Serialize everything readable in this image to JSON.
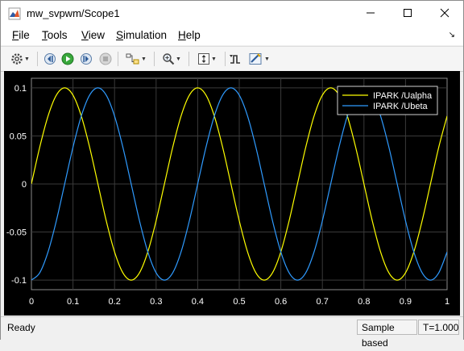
{
  "window": {
    "title": "mw_svpwm/Scope1",
    "controls": [
      "minimize-icon",
      "maximize-icon",
      "close-icon"
    ]
  },
  "menubar": {
    "items": [
      {
        "label": "File",
        "mnemonic": "F"
      },
      {
        "label": "Tools",
        "mnemonic": "T"
      },
      {
        "label": "View",
        "mnemonic": "V"
      },
      {
        "label": "Simulation",
        "mnemonic": "S"
      },
      {
        "label": "Help",
        "mnemonic": "H"
      }
    ]
  },
  "toolbar": {
    "icons": [
      "settings-icon",
      "step-back-icon",
      "run-icon",
      "step-forward-icon",
      "stop-icon",
      "highlight-block-icon",
      "zoom-icon",
      "autoscale-icon",
      "triggers-icon",
      "measurements-icon"
    ]
  },
  "colors": {
    "ualpha": "#ffff00",
    "ubeta": "#2f9bff",
    "plot_bg": "#000000",
    "grid": "#3a3a3a",
    "axis_text": "#ffffff"
  },
  "chart_data": {
    "type": "line",
    "title": "",
    "xlabel": "",
    "ylabel": "",
    "xlim": [
      0,
      1
    ],
    "ylim": [
      -0.11,
      0.11
    ],
    "xticks": [
      "0",
      "0.1",
      "0.2",
      "0.3",
      "0.4",
      "0.5",
      "0.6",
      "0.7",
      "0.8",
      "0.9",
      "1"
    ],
    "yticks": [
      "0.1",
      "0.05",
      "0",
      "-0.05",
      "-0.1"
    ],
    "ytick_values": [
      0.1,
      0.05,
      0,
      -0.05,
      -0.1
    ],
    "grid": true,
    "legend_position": "top-right",
    "series": [
      {
        "name": "IPARK /Ualpha",
        "color": "#ffff00",
        "x": [
          0,
          0.02,
          0.04,
          0.06,
          0.08,
          0.1,
          0.12,
          0.14,
          0.16,
          0.18,
          0.2,
          0.22,
          0.24,
          0.26,
          0.28,
          0.3,
          0.32,
          0.34,
          0.36,
          0.38,
          0.4,
          0.42,
          0.44,
          0.46,
          0.48,
          0.5,
          0.52,
          0.54,
          0.56,
          0.58,
          0.6,
          0.62,
          0.64,
          0.66,
          0.68,
          0.7,
          0.72,
          0.74,
          0.76,
          0.78,
          0.8,
          0.82,
          0.84,
          0.86,
          0.88,
          0.9,
          0.92,
          0.94,
          0.96,
          0.98,
          1.0
        ],
        "values": [
          0,
          0.0383,
          0.0707,
          0.0924,
          0.1,
          0.0924,
          0.0707,
          0.0383,
          0,
          -0.0383,
          -0.0707,
          -0.0924,
          -0.1,
          -0.0924,
          -0.0707,
          -0.0383,
          0,
          0.0383,
          0.0707,
          0.0924,
          0.1,
          0.0924,
          0.0707,
          0.0383,
          0,
          -0.0383,
          -0.0707,
          -0.0924,
          -0.1,
          -0.0924,
          -0.0707,
          -0.0383,
          0,
          0.0383,
          0.0707,
          0.0924,
          0.1,
          0.0924,
          0.0707,
          0.0383,
          0,
          -0.0383,
          -0.0707,
          -0.0924,
          -0.1,
          -0.0924,
          -0.0707,
          -0.0383,
          0,
          0.0383,
          0.0707
        ]
      },
      {
        "name": "IPARK /Ubeta",
        "color": "#2f9bff",
        "x": [
          0,
          0.02,
          0.04,
          0.06,
          0.08,
          0.1,
          0.12,
          0.14,
          0.16,
          0.18,
          0.2,
          0.22,
          0.24,
          0.26,
          0.28,
          0.3,
          0.32,
          0.34,
          0.36,
          0.38,
          0.4,
          0.42,
          0.44,
          0.46,
          0.48,
          0.5,
          0.52,
          0.54,
          0.56,
          0.58,
          0.6,
          0.62,
          0.64,
          0.66,
          0.68,
          0.7,
          0.72,
          0.74,
          0.76,
          0.78,
          0.8,
          0.82,
          0.84,
          0.86,
          0.88,
          0.9,
          0.92,
          0.94,
          0.96,
          0.98,
          1.0
        ],
        "values": [
          -0.1,
          -0.0924,
          -0.0707,
          -0.0383,
          0,
          0.0383,
          0.0707,
          0.0924,
          0.1,
          0.0924,
          0.0707,
          0.0383,
          0,
          -0.0383,
          -0.0707,
          -0.0924,
          -0.1,
          -0.0924,
          -0.0707,
          -0.0383,
          0,
          0.0383,
          0.0707,
          0.0924,
          0.1,
          0.0924,
          0.0707,
          0.0383,
          0,
          -0.0383,
          -0.0707,
          -0.0924,
          -0.1,
          -0.0924,
          -0.0707,
          -0.0383,
          0,
          0.0383,
          0.0707,
          0.0924,
          0.1,
          0.0924,
          0.0707,
          0.0383,
          0,
          -0.0383,
          -0.0707,
          -0.0924,
          -0.1,
          -0.0924,
          -0.0707
        ]
      }
    ]
  },
  "status": {
    "ready": "Ready",
    "mode": "Sample based",
    "time": "T=1.000"
  }
}
